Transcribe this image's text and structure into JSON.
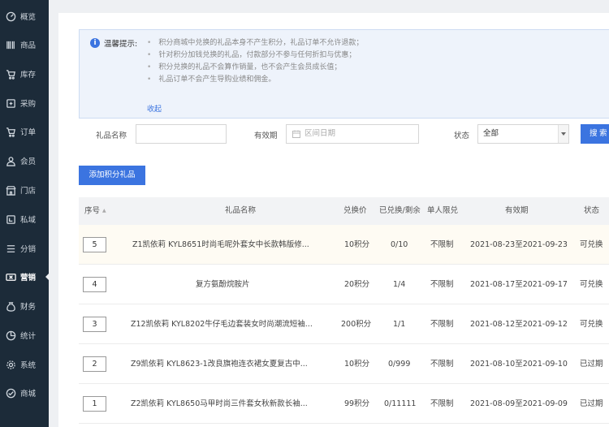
{
  "sidebar": {
    "items": [
      {
        "label": "概览",
        "icon": "dashboard-icon"
      },
      {
        "label": "商品",
        "icon": "barcode-icon"
      },
      {
        "label": "库存",
        "icon": "cart-icon"
      },
      {
        "label": "采购",
        "icon": "purchase-icon"
      },
      {
        "label": "订单",
        "icon": "cart-icon"
      },
      {
        "label": "会员",
        "icon": "user-icon"
      },
      {
        "label": "门店",
        "icon": "store-icon"
      },
      {
        "label": "私域",
        "icon": "private-domain-icon"
      },
      {
        "label": "分销",
        "icon": "menu-icon"
      },
      {
        "label": "营销",
        "icon": "ticket-icon"
      },
      {
        "label": "财务",
        "icon": "money-bag-icon"
      },
      {
        "label": "统计",
        "icon": "pie-chart-icon"
      },
      {
        "label": "系统",
        "icon": "gear-icon"
      },
      {
        "label": "商城",
        "icon": "mall-icon"
      }
    ],
    "active_index": 9
  },
  "notice": {
    "title": "温馨提示:",
    "items": [
      "积分商城中兑换的礼品本身不产生积分，礼品订单不允许退款；",
      "针对积分加钱兑换的礼品，付款部分不参与任何折扣与优惠；",
      "积分兑换的礼品不会算作销量，也不会产生会员成长值；",
      "礼品订单不会产生导购业绩和佣金。"
    ],
    "collapse_label": "收起"
  },
  "filters": {
    "gift_name_label": "礼品名称",
    "gift_name_value": "",
    "validity_label": "有效期",
    "validity_placeholder": "区间日期",
    "status_label": "状态",
    "status_value": "全部",
    "search_label": "搜 索"
  },
  "add_button_label": "添加积分礼品",
  "table": {
    "headers": [
      "序号",
      "礼品名称",
      "兑换价",
      "已兑换/剩余",
      "单人限兑",
      "有效期",
      "状态"
    ],
    "rows": [
      {
        "seq": "5",
        "name": "Z1凯依莉 KYL8651时尚毛呢外套女中长款韩版修...",
        "price": "10积分",
        "redeemed": "0/10",
        "limit": "不限制",
        "validity": "2021-08-23至2021-09-23",
        "status": "可兑换"
      },
      {
        "seq": "4",
        "name": "复方氨酚烷胺片",
        "price": "20积分",
        "redeemed": "1/4",
        "limit": "不限制",
        "validity": "2021-08-17至2021-09-17",
        "status": "可兑换"
      },
      {
        "seq": "3",
        "name": "Z12凯依莉 KYL8202牛仔毛边套装女时尚潮流短袖...",
        "price": "200积分",
        "redeemed": "1/1",
        "limit": "不限制",
        "validity": "2021-08-12至2021-09-12",
        "status": "可兑换"
      },
      {
        "seq": "2",
        "name": "Z9凯依莉 KYL8623-1改良旗袍连衣裙女夏复古中...",
        "price": "10积分",
        "redeemed": "0/999",
        "limit": "不限制",
        "validity": "2021-08-10至2021-09-10",
        "status": "已过期"
      },
      {
        "seq": "1",
        "name": "Z2凯依莉 KYL8650马甲时尚三件套女秋新款长袖...",
        "price": "99积分",
        "redeemed": "0/11111",
        "limit": "不限制",
        "validity": "2021-08-09至2021-09-09",
        "status": "已过期"
      }
    ]
  }
}
